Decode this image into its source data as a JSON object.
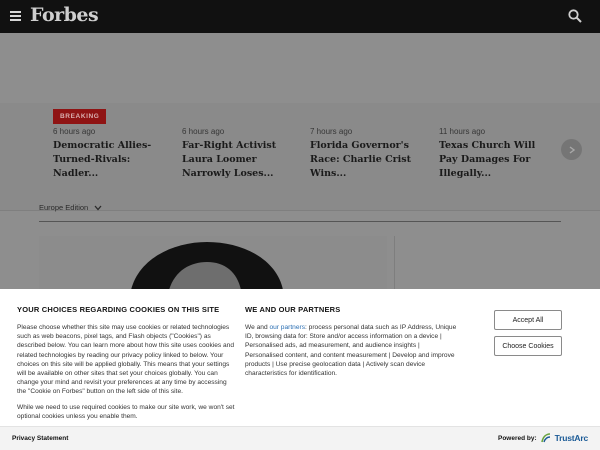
{
  "header": {
    "logo": "Forbes",
    "menu_icon": "hamburger-menu-icon",
    "search_icon": "search-icon"
  },
  "breaking": {
    "badge": "BREAKING",
    "stories": [
      {
        "time": "6 hours ago",
        "headline": "Democratic Allies-Turned-Rivals: Nadler..."
      },
      {
        "time": "6 hours ago",
        "headline": "Far-Right Activist Laura Loomer Narrowly Loses..."
      },
      {
        "time": "7 hours ago",
        "headline": "Florida Governor's Race: Charlie Crist Wins..."
      },
      {
        "time": "11 hours ago",
        "headline": "Texas Church Will Pay Damages For Illegally..."
      }
    ],
    "next_icon": "chevron-right-icon"
  },
  "edition": {
    "label": "Europe Edition"
  },
  "cookie": {
    "left_title": "YOUR CHOICES REGARDING COOKIES ON THIS SITE",
    "left_p1": "Please choose whether this site may use cookies or related technologies such as web beacons, pixel tags, and Flash objects (\"Cookies\") as described below. You can learn more about how this site uses cookies and related technologies by reading our privacy policy linked to below. Your choices on this site will be applied globally. This means that your settings will be available on other sites that set your choices globally. You can change your mind and revisit your preferences at any time by accessing the \"Cookie on Forbes\" button on the left side of this site.",
    "left_p2": "While we need to use required cookies to make our site work, we won't set optional cookies unless you enable them.",
    "right_title": "WE AND OUR PARTNERS",
    "right_prefix": "We and ",
    "right_link": "our partners",
    "right_body": ": process personal data such as IP Address, Unique ID, browsing data for: Store and/or access information on a device | Personalised ads, ad measurement, and audience insights | Personalised content, and content measurement | Develop and improve products | Use precise geolocation data | Actively scan device characteristics for identification.",
    "accept_label": "Accept All",
    "choose_label": "Choose Cookies",
    "privacy_label": "Privacy Statement",
    "powered_label": "Powered by:",
    "trustarc_label": "TrustArc",
    "trustarc_icon": "trustarc-logo-icon"
  },
  "colors": {
    "header_bg": "#111111",
    "breaking_badge": "#8f1414",
    "link": "#2b6fb3",
    "trustarc": "#1a5a96",
    "overlay": "#8e8e8e"
  }
}
